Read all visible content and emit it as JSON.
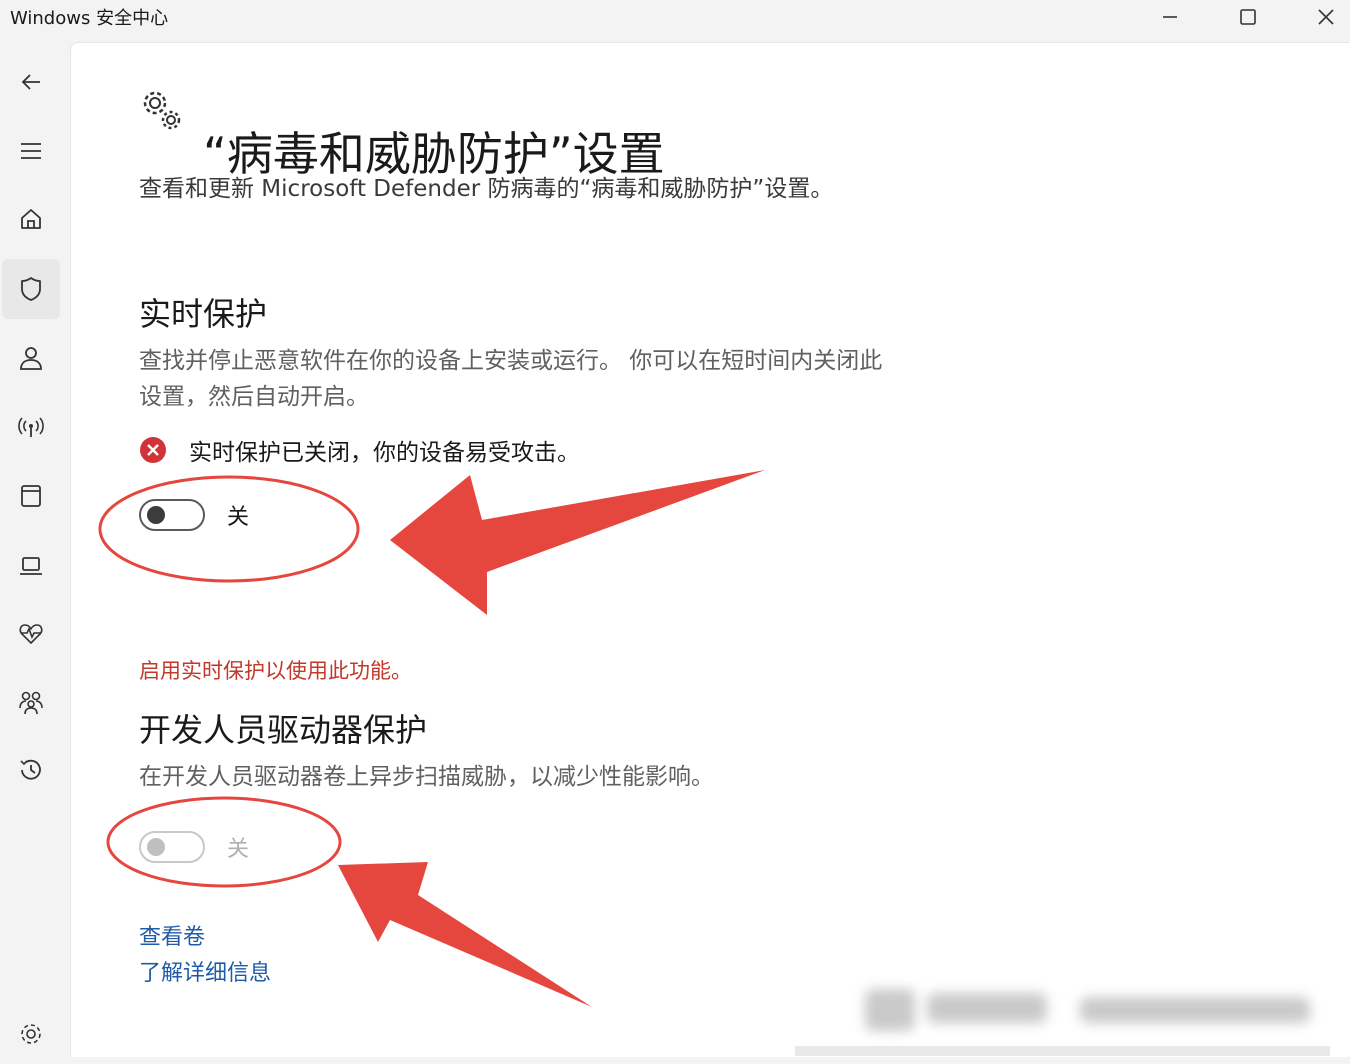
{
  "window": {
    "title": "Windows 安全中心"
  },
  "sidebar": {
    "items": [
      {
        "icon": "back-arrow-icon"
      },
      {
        "icon": "hamburger-menu-icon"
      },
      {
        "icon": "home-icon"
      },
      {
        "icon": "shield-icon",
        "active": true
      },
      {
        "icon": "person-icon"
      },
      {
        "icon": "wireless-signal-icon"
      },
      {
        "icon": "app-browser-icon"
      },
      {
        "icon": "laptop-icon"
      },
      {
        "icon": "heart-pulse-icon"
      },
      {
        "icon": "family-icon"
      },
      {
        "icon": "history-icon"
      },
      {
        "icon": "settings-gear-icon"
      }
    ]
  },
  "page": {
    "title": "“病毒和威胁防护”设置",
    "description": "查看和更新 Microsoft Defender 防病毒的“病毒和威胁防护”设置。"
  },
  "realtime": {
    "title": "实时保护",
    "description_line1": "查找并停止恶意软件在你的设备上安装或运行。 你可以在短时间内关闭此",
    "description_line2": "设置，然后自动开启。",
    "status": "实时保护已关闭，你的设备易受攻击。",
    "toggle_label": "关",
    "toggle_on": false
  },
  "devdrive": {
    "warning": "启用实时保护以使用此功能。",
    "title": "开发人员驱动器保护",
    "description": "在开发人员驱动器卷上异步扫描威胁，以减少性能影响。",
    "toggle_label": "关",
    "toggle_on": false,
    "toggle_disabled": true
  },
  "links": {
    "view_volumes": "查看卷",
    "learn_more": "了解详细信息"
  },
  "colors": {
    "accent_link": "#1f5ba8",
    "error_red": "#d13438",
    "warning_text": "#c0392b",
    "annotation_red": "#e5473e"
  }
}
